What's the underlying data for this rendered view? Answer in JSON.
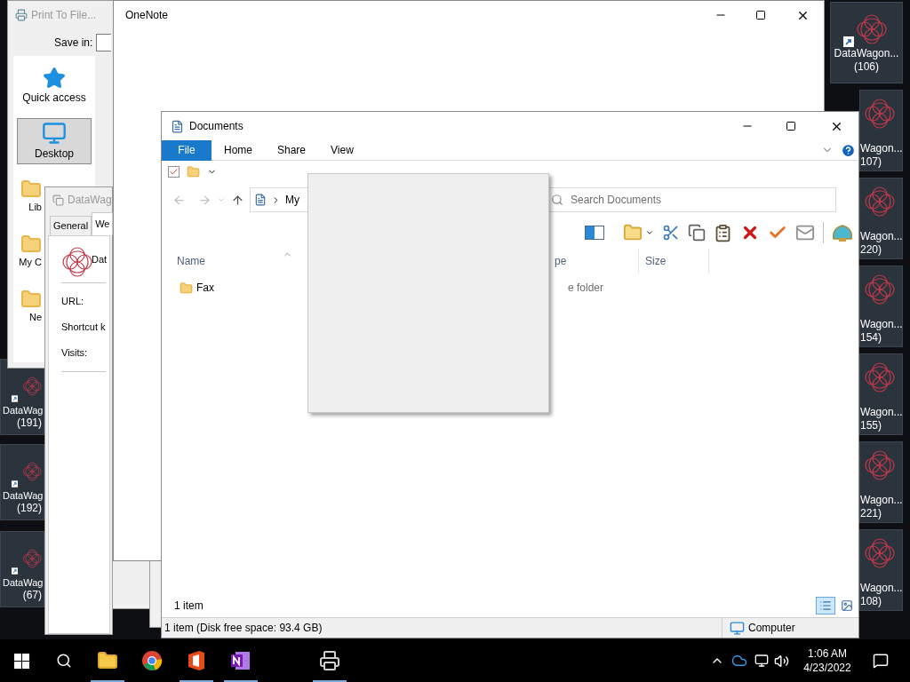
{
  "desktop_left": [
    {
      "label": "DataWag",
      "number": "(191)"
    },
    {
      "label": "DataWag",
      "number": "(192)"
    },
    {
      "label": "DataWag",
      "number": "(67)"
    }
  ],
  "desktop_right": [
    {
      "label": "DataWagon...",
      "number": "(106)"
    },
    {
      "label": "Wagon...",
      "number": "107)"
    },
    {
      "label": "Wagon...",
      "number": "220)"
    },
    {
      "label": "Wagon...",
      "number": "154)"
    },
    {
      "label": "Wagon...",
      "number": "155)"
    },
    {
      "label": "Wagon...",
      "number": "221)"
    },
    {
      "label": "Wagon...",
      "number": "108)"
    }
  ],
  "print_window": {
    "title": "Print To File...",
    "save_in_label": "Save in:",
    "places": [
      {
        "label": "Quick access",
        "selected": false
      },
      {
        "label": "Desktop",
        "selected": true
      },
      {
        "label": "Lib",
        "selected": false
      },
      {
        "label": "My C",
        "selected": false
      },
      {
        "label": "Ne",
        "selected": false
      }
    ]
  },
  "properties_window": {
    "title": "DataWag",
    "tabs": [
      {
        "label": "General",
        "selected": false
      },
      {
        "label": "We",
        "selected": true
      }
    ],
    "name": "Dat",
    "fields": [
      "URL:",
      "Shortcut k",
      "Visits:"
    ]
  },
  "onenote": {
    "title": "OneNote"
  },
  "explorer": {
    "title": "Documents",
    "ribbon_tabs": [
      {
        "label": "File",
        "selected": true
      },
      {
        "label": "Home",
        "selected": false
      },
      {
        "label": "Share",
        "selected": false
      },
      {
        "label": "View",
        "selected": false
      }
    ],
    "address": "My",
    "search_placeholder": "Search Documents",
    "columns": [
      "Name",
      "pe",
      "Size"
    ],
    "rows": [
      {
        "name": "Fax",
        "type": "e folder"
      }
    ],
    "item_count": "1 item",
    "status": "1 item (Disk free space: 93.4 GB)",
    "location": "Computer",
    "view_buttons": [
      {
        "kind": "details",
        "selected": true
      },
      {
        "kind": "thumbnails",
        "selected": false
      }
    ]
  },
  "taskbar": {
    "apps": [
      {
        "kind": "explorer",
        "running": true
      },
      {
        "kind": "chrome",
        "running": false
      },
      {
        "kind": "office",
        "running": true
      },
      {
        "kind": "onenote",
        "running": true
      },
      {
        "kind": "printer",
        "running": true
      }
    ],
    "time": "1:06 AM",
    "date": "4/23/2022"
  }
}
